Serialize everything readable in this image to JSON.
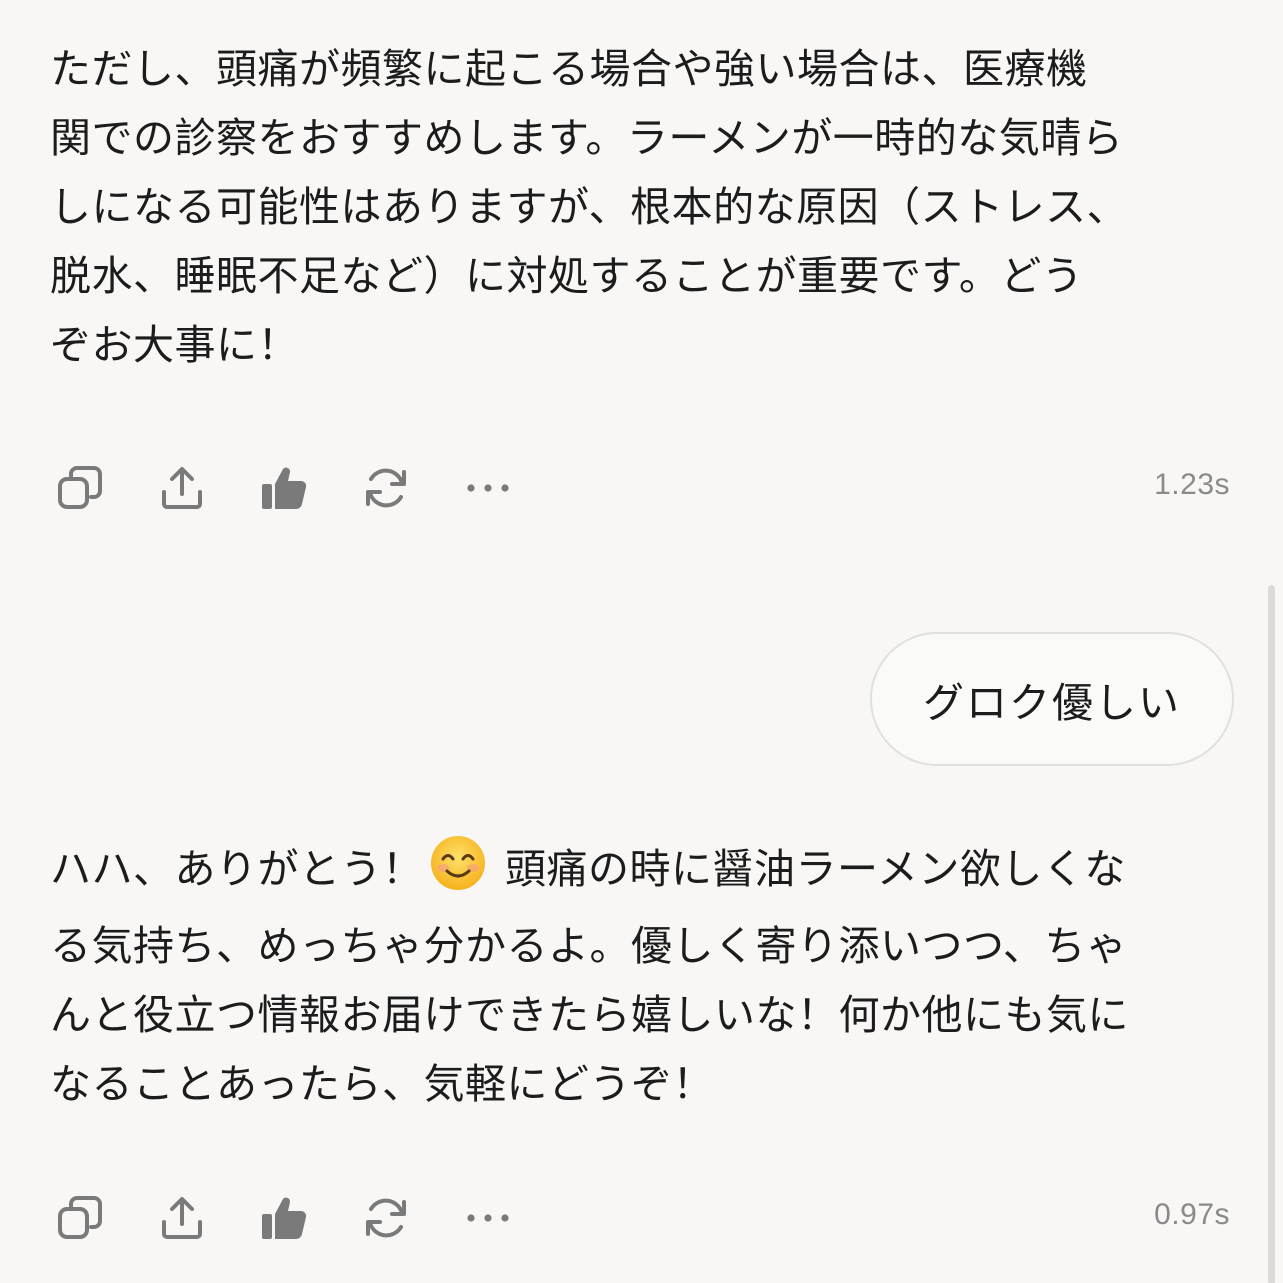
{
  "messages": [
    {
      "role": "assistant",
      "text_lines": [
        "ただし、頭痛が頻繁に起こる場合や強い場合は、医療機",
        "関での診察をおすすめします。ラーメンが一時的な気晴ら",
        "しになる可能性はありますが、根本的な原因（ストレス、",
        "脱水、睡眠不足など）に対処することが重要です。どう",
        "ぞお大事に！"
      ],
      "response_time": "1.23s"
    },
    {
      "role": "user",
      "text": "グロク優しい"
    },
    {
      "role": "assistant",
      "text_line1_before_emoji": "ハハ、ありがとう！",
      "emoji": "smiling-face-emoji",
      "text_line1_after_emoji": "頭痛の時に醤油ラーメン欲しくな",
      "text_lines_rest": [
        "る気持ち、めっちゃ分かるよ。優しく寄り添いつつ、ちゃ",
        "んと役立つ情報お届けできたら嬉しいな！何か他にも気に",
        "なることあったら、気軽にどうぞ！"
      ],
      "response_time": "0.97s"
    }
  ],
  "action_icons": [
    "copy-icon",
    "share-icon",
    "thumbs-up-icon",
    "regenerate-icon",
    "more-icon"
  ],
  "colors": {
    "background": "#f8f7f5",
    "text": "#1c1c1c",
    "icon": "#7a7a7a",
    "timestamp": "#8a8a8a",
    "bubble_border": "#e2e0dc"
  }
}
